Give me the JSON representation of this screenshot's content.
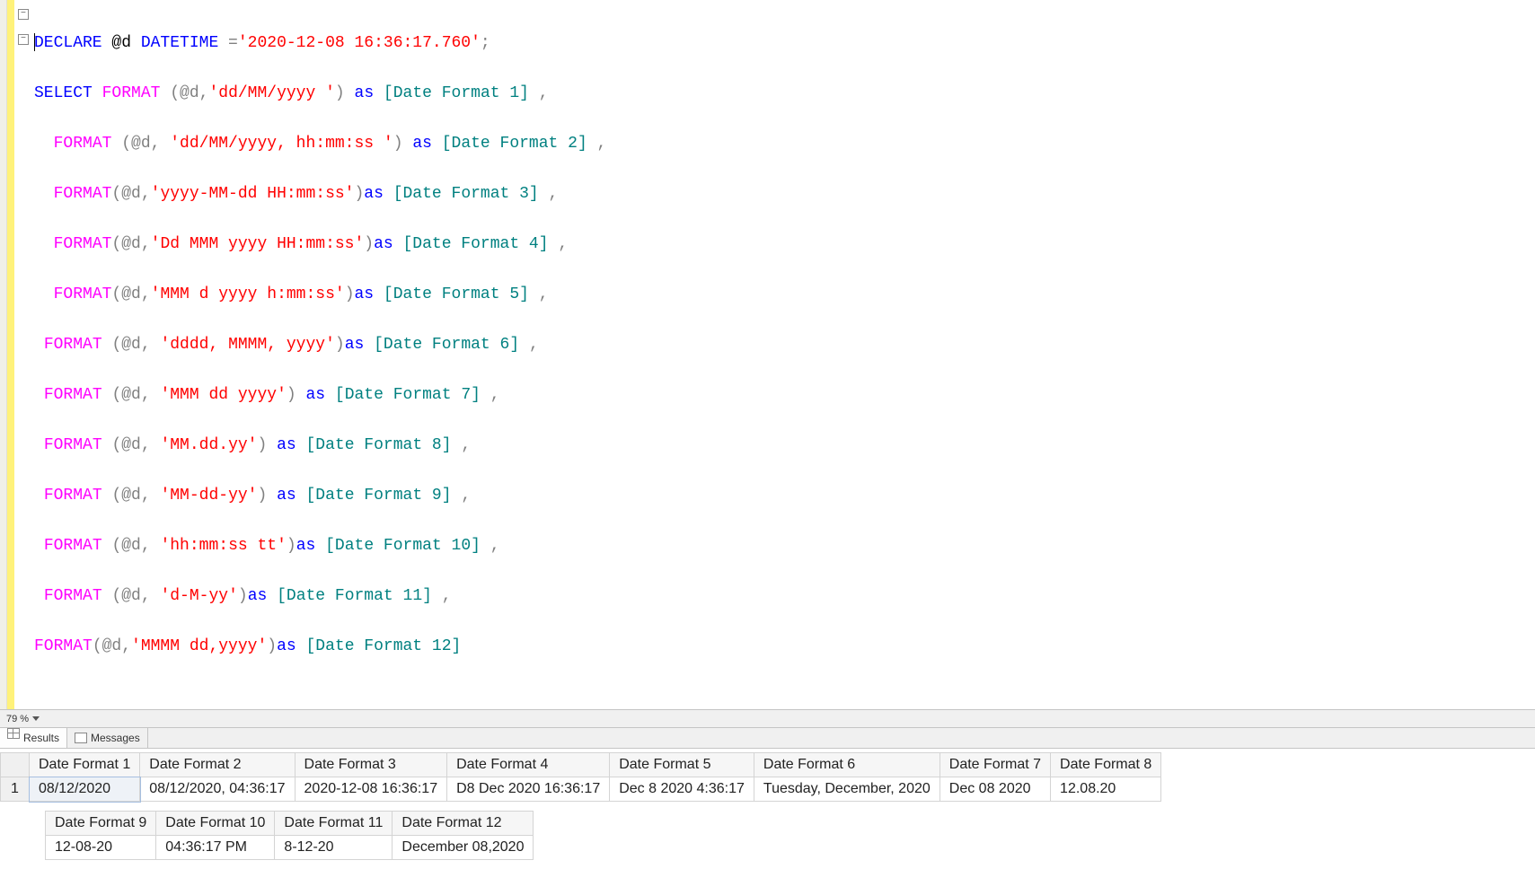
{
  "code": {
    "line1": {
      "kw1": "DECLARE ",
      "var": "@d ",
      "type": "DATETIME ",
      "eq": "=",
      "str": "'2020-12-08 16:36:17.760'",
      "term": ";"
    },
    "line2": {
      "kw": "SELECT ",
      "fn": "FORMAT ",
      "args": "(@d,",
      "str": "'dd/MM/yyyy '",
      "close": ") ",
      "askw": "as ",
      "alias": "[Date Format 1] ",
      "comma": ","
    },
    "line3": {
      "fn": "FORMAT ",
      "args": "(@d, ",
      "str": "'dd/MM/yyyy, hh:mm:ss '",
      "close": ") ",
      "askw": "as ",
      "alias": "[Date Format 2] ",
      "comma": ","
    },
    "line4": {
      "fn": "FORMAT",
      "args": "(@d,",
      "str": "'yyyy-MM-dd HH:mm:ss'",
      "close": ")",
      "askw": "as ",
      "alias": "[Date Format 3] ",
      "comma": ","
    },
    "line5": {
      "fn": "FORMAT",
      "args": "(@d,",
      "str": "'Dd MMM yyyy HH:mm:ss'",
      "close": ")",
      "askw": "as ",
      "alias": "[Date Format 4] ",
      "comma": ","
    },
    "line6": {
      "fn": "FORMAT",
      "args": "(@d,",
      "str": "'MMM d yyyy h:mm:ss'",
      "close": ")",
      "askw": "as ",
      "alias": "[Date Format 5] ",
      "comma": ","
    },
    "line7": {
      "fn": "FORMAT ",
      "args": "(@d, ",
      "str": "'dddd, MMMM, yyyy'",
      "close": ")",
      "askw": "as ",
      "alias": "[Date Format 6] ",
      "comma": ","
    },
    "line8": {
      "fn": "FORMAT ",
      "args": "(@d, ",
      "str": "'MMM dd yyyy'",
      "close": ") ",
      "askw": "as ",
      "alias": "[Date Format 7] ",
      "comma": ","
    },
    "line9": {
      "fn": "FORMAT ",
      "args": "(@d, ",
      "str": "'MM.dd.yy'",
      "close": ") ",
      "askw": "as ",
      "alias": "[Date Format 8] ",
      "comma": ","
    },
    "line10": {
      "fn": "FORMAT ",
      "args": "(@d, ",
      "str": "'MM-dd-yy'",
      "close": ") ",
      "askw": "as ",
      "alias": "[Date Format 9] ",
      "comma": ","
    },
    "line11": {
      "fn": "FORMAT ",
      "args": "(@d, ",
      "str": "'hh:mm:ss tt'",
      "close": ")",
      "askw": "as ",
      "alias": "[Date Format 10] ",
      "comma": ","
    },
    "line12": {
      "fn": "FORMAT ",
      "args": "(@d, ",
      "str": "'d-M-yy'",
      "close": ")",
      "askw": "as ",
      "alias": "[Date Format 11] ",
      "comma": ","
    },
    "line13": {
      "fn": "FORMAT",
      "args": "(@d,",
      "str": "'MMMM dd,yyyy'",
      "close": ")",
      "askw": "as ",
      "alias": "[Date Format 12]"
    }
  },
  "zoom": {
    "value": "79 %"
  },
  "tabs": {
    "results": "Results",
    "messages": "Messages"
  },
  "results1": {
    "rownum": "1",
    "headers": [
      "Date Format 1",
      "Date Format 2",
      "Date Format 3",
      "Date Format 4",
      "Date Format 5",
      "Date Format 6",
      "Date Format 7",
      "Date Format 8"
    ],
    "row": [
      "08/12/2020",
      "08/12/2020, 04:36:17",
      "2020-12-08 16:36:17",
      "D8 Dec 2020 16:36:17",
      "Dec 8 2020 4:36:17",
      "Tuesday, December, 2020",
      "Dec 08 2020",
      "12.08.20"
    ]
  },
  "results2": {
    "headers": [
      "Date Format 9",
      "Date Format 10",
      "Date Format 11",
      "Date Format 12"
    ],
    "row": [
      "12-08-20",
      "04:36:17 PM",
      "8-12-20",
      "December 08,2020"
    ]
  }
}
